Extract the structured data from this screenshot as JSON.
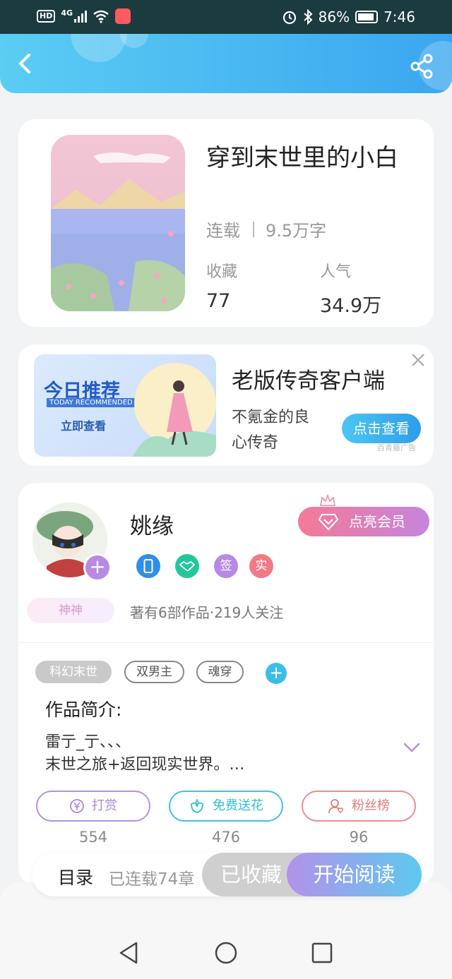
{
  "status_bar": {
    "hd": "HD",
    "network": "4G",
    "battery": "86%",
    "time": "7:46"
  },
  "book": {
    "title": "穿到末世里的小白",
    "status": "连载",
    "word_count": "9.5万字",
    "favorites_label": "收藏",
    "favorites_value": "77",
    "popularity_label": "人气",
    "popularity_value": "34.9万"
  },
  "ad": {
    "image_title": "今日推荐",
    "image_subtitle": "TODAY RECOMMENDED",
    "image_cta": "立即查看",
    "title": "老版传奇客户端",
    "desc": "不氪金的良心传奇",
    "button": "点击查看",
    "source": "百青藤广告"
  },
  "author": {
    "name": "姚缘",
    "vip_button": "点亮会员",
    "badges": [
      {
        "label": "",
        "icon": "phone-icon",
        "color": "#2f8fe8"
      },
      {
        "label": "",
        "icon": "handshake-icon",
        "color": "#21c79a"
      },
      {
        "label": "签",
        "icon": "",
        "color": "#b889e4"
      },
      {
        "label": "实",
        "icon": "",
        "color": "#f07a85"
      }
    ],
    "rank": "神神",
    "stats": "著有6部作品·219人关注"
  },
  "tags": [
    "科幻末世",
    "双男主",
    "魂穿"
  ],
  "intro": {
    "title": "作品简介:",
    "text": "雷亍_亍、、、\n末世之旅+返回现实世界。…"
  },
  "actions": [
    {
      "label": "打赏",
      "count": "554",
      "icon": "yen-coin-icon",
      "color": "#a889d8"
    },
    {
      "label": "免费送花",
      "count": "476",
      "icon": "flower-icon",
      "color": "#32bfd6"
    },
    {
      "label": "粉丝榜",
      "count": "96",
      "icon": "fan-rank-icon",
      "color": "#e27a7a"
    }
  ],
  "bottom_bar": {
    "toc": "目录",
    "chapters": "已连载74章",
    "favorited": "已收藏",
    "read": "开始阅读"
  }
}
